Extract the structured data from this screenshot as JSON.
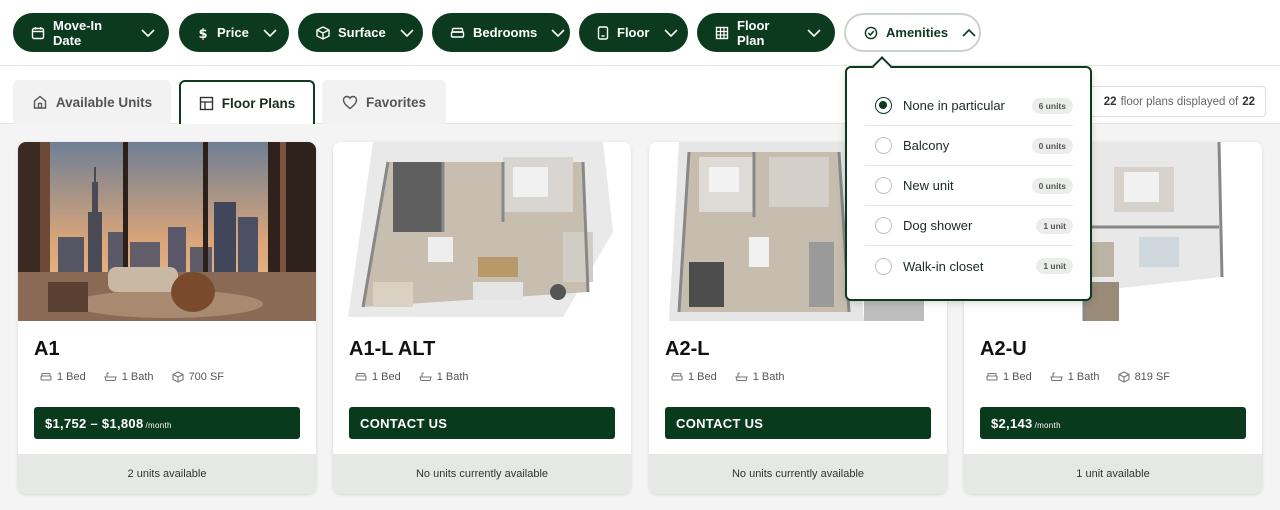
{
  "filters": [
    {
      "label": "Move-In Date",
      "icon": "calendar-icon"
    },
    {
      "label": "Price",
      "icon": "dollar-icon"
    },
    {
      "label": "Surface",
      "icon": "cube-icon"
    },
    {
      "label": "Bedrooms",
      "icon": "bed-icon"
    },
    {
      "label": "Floor",
      "icon": "building-icon"
    },
    {
      "label": "Floor Plan",
      "icon": "grid-icon"
    },
    {
      "label": "Amenities",
      "icon": "check-circle-icon",
      "state": "open"
    }
  ],
  "tabs": [
    {
      "label": "Available Units",
      "icon": "home-icon"
    },
    {
      "label": "Floor Plans",
      "icon": "floorplan-icon",
      "active": true
    },
    {
      "label": "Favorites",
      "icon": "heart-icon"
    }
  ],
  "count": {
    "shown": "22",
    "mid": "floor plans displayed of",
    "total": "22"
  },
  "amenities": [
    {
      "label": "None in particular",
      "count": "6 units",
      "selected": true
    },
    {
      "label": "Balcony",
      "count": "0 units",
      "selected": false
    },
    {
      "label": "New unit",
      "count": "0 units",
      "selected": false
    },
    {
      "label": "Dog shower",
      "count": "1 unit",
      "selected": false
    },
    {
      "label": "Walk-in closet",
      "count": "1 unit",
      "selected": false
    }
  ],
  "cards": [
    {
      "name": "A1",
      "bed": "1 Bed",
      "bath": "1 Bath",
      "sf": "700 SF",
      "price": "$1,752 – $1,808",
      "per": "/month",
      "availability": "2 units available",
      "image": "city-view-photo"
    },
    {
      "name": "A1-L ALT",
      "bed": "1 Bed",
      "bath": "1 Bath",
      "sf": "",
      "price": "CONTACT US",
      "per": "",
      "availability": "No units currently available",
      "image": "3d-floor-plan"
    },
    {
      "name": "A2-L",
      "bed": "1 Bed",
      "bath": "1 Bath",
      "sf": "",
      "price": "CONTACT US",
      "per": "",
      "availability": "No units currently available",
      "image": "3d-floor-plan"
    },
    {
      "name": "A2-U",
      "bed": "1 Bed",
      "bath": "1 Bath",
      "sf": "819 SF",
      "price": "$2,143",
      "per": "/month",
      "availability": "1 unit available",
      "image": "3d-floor-plan"
    }
  ],
  "colors": {
    "brand": "#0c3a1f",
    "available_bg": "#e6e8e6"
  }
}
